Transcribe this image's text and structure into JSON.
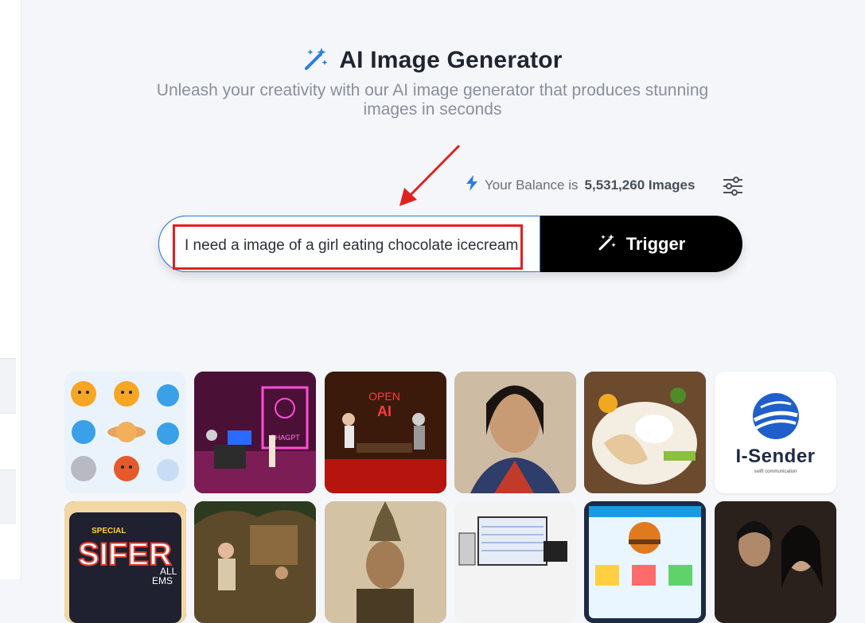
{
  "header": {
    "title": "AI Image Generator",
    "subtitle": "Unleash your creativity with our AI image generator that produces stunning images in seconds"
  },
  "balance": {
    "prefix": "Your Balance is",
    "amount": "5,531,260 Images"
  },
  "prompt": {
    "value": "I need a image of a girl eating chocolate icecream"
  },
  "trigger": {
    "label": "Trigger"
  },
  "gallery": {
    "tiles": [
      {
        "label": "Emoji planets"
      },
      {
        "label": "Neon office with robot"
      },
      {
        "label": "OPEN AI meeting"
      },
      {
        "label": "Portrait of woman"
      },
      {
        "label": "Chicken rice dish"
      },
      {
        "label": "I-Sender logo"
      },
      {
        "label": "Special sticker art"
      },
      {
        "label": "Jungle scene"
      },
      {
        "label": "Thai warrior portrait"
      },
      {
        "label": "POS sketch"
      },
      {
        "label": "Burger menu app"
      },
      {
        "label": "Couple portrait"
      }
    ],
    "partial_text_1": "OPEN",
    "partial_text_2": "AI",
    "partial_text_3": "CHAGPT",
    "logo_name": "I-Sender",
    "logo_tagline": "swift communication",
    "sticker_text": "SIFER",
    "sticker_small": "SPECIAL",
    "sticker_small_2": "ALL",
    "sticker_small_3": "EMS"
  },
  "colors": {
    "accent": "#2a7de1",
    "highlight": "#e02020",
    "button_bg": "#000000"
  },
  "icons": {
    "title_icon": "magic-wand-icon",
    "balance_icon": "lightning-icon",
    "settings_icon": "sliders-icon",
    "trigger_icon": "magic-wand-icon"
  }
}
